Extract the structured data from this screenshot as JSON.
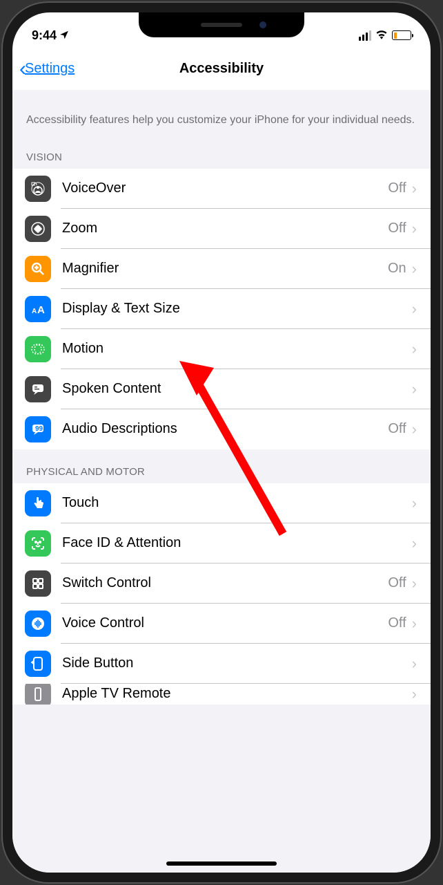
{
  "statusBar": {
    "time": "9:44"
  },
  "nav": {
    "backLabel": "Settings",
    "title": "Accessibility"
  },
  "description": "Accessibility features help you customize your iPhone for your individual needs.",
  "sections": [
    {
      "header": "VISION",
      "rows": [
        {
          "icon": "voiceover",
          "label": "VoiceOver",
          "status": "Off"
        },
        {
          "icon": "zoom",
          "label": "Zoom",
          "status": "Off"
        },
        {
          "icon": "magnifier",
          "label": "Magnifier",
          "status": "On"
        },
        {
          "icon": "display",
          "label": "Display & Text Size",
          "status": ""
        },
        {
          "icon": "motion",
          "label": "Motion",
          "status": ""
        },
        {
          "icon": "spoken",
          "label": "Spoken Content",
          "status": ""
        },
        {
          "icon": "audio",
          "label": "Audio Descriptions",
          "status": "Off"
        }
      ]
    },
    {
      "header": "PHYSICAL AND MOTOR",
      "rows": [
        {
          "icon": "touch",
          "label": "Touch",
          "status": ""
        },
        {
          "icon": "faceid",
          "label": "Face ID & Attention",
          "status": ""
        },
        {
          "icon": "switch",
          "label": "Switch Control",
          "status": "Off"
        },
        {
          "icon": "voicecontrol",
          "label": "Voice Control",
          "status": "Off"
        },
        {
          "icon": "sidebutton",
          "label": "Side Button",
          "status": ""
        },
        {
          "icon": "appletv",
          "label": "Apple TV Remote",
          "status": "",
          "partial": true
        }
      ]
    }
  ]
}
